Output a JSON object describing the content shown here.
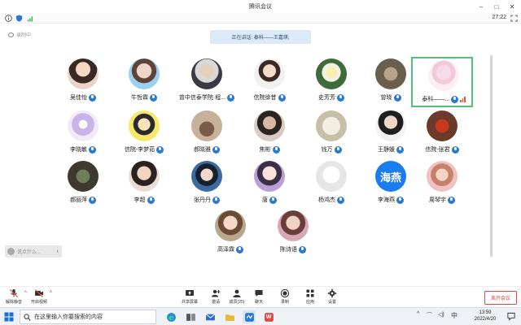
{
  "window": {
    "title": "腾讯会议"
  },
  "infobar": {
    "timer": "27:22"
  },
  "recording": {
    "label": "录制中"
  },
  "speaking": {
    "text": "正在讲话: 泰科——王嘉琪;"
  },
  "participants": [
    {
      "name": "吴佳怡",
      "muted": false
    },
    {
      "name": "牛哲霖",
      "muted": false
    },
    {
      "name": "曾中信泰学院·程...",
      "muted": false
    },
    {
      "name": "信院徐昔",
      "muted": false
    },
    {
      "name": "史芳芳",
      "muted": false
    },
    {
      "name": "曾晓",
      "muted": false
    },
    {
      "name": "泰科——...",
      "muted": false,
      "speaking": true
    },
    {
      "name": "李晓敏",
      "muted": true
    },
    {
      "name": "信院-李梦茹",
      "muted": false
    },
    {
      "name": "郝晓雅",
      "muted": false
    },
    {
      "name": "焦彬",
      "muted": false
    },
    {
      "name": "钱万",
      "muted": false
    },
    {
      "name": "王静媛",
      "muted": false
    },
    {
      "name": "信院-张君",
      "muted": false
    },
    {
      "name": "郝丽萍",
      "muted": false
    },
    {
      "name": "李超",
      "muted": false
    },
    {
      "name": "张丹丹",
      "muted": false
    },
    {
      "name": "唐",
      "muted": true
    },
    {
      "name": "杨鸿杰",
      "muted": false
    },
    {
      "name": "李海燕",
      "muted": false,
      "avatar_text": "海燕"
    },
    {
      "name": "周琴宇",
      "muted": false
    },
    {
      "name": "高泽霖",
      "muted": false
    },
    {
      "name": "陈诗语",
      "muted": false
    }
  ],
  "chat": {
    "placeholder": "说点什么..."
  },
  "toolbar": {
    "unmute": "解除静音",
    "video": "开启视频",
    "share": "共享屏幕",
    "invite": "邀请",
    "members": "成员(25)",
    "chat": "聊天",
    "record": "录制",
    "apps": "应用",
    "settings": "设置",
    "leave": "离开会议"
  },
  "taskbar": {
    "search_placeholder": "在这里输入你要搜索的内容",
    "time": "13:59",
    "date": "2022/4/20",
    "ime": "中",
    "wps_label": "W"
  },
  "colors": {
    "accent": "#2a78d8",
    "speaking_border": "#4cc377",
    "leave": "#e04848"
  }
}
